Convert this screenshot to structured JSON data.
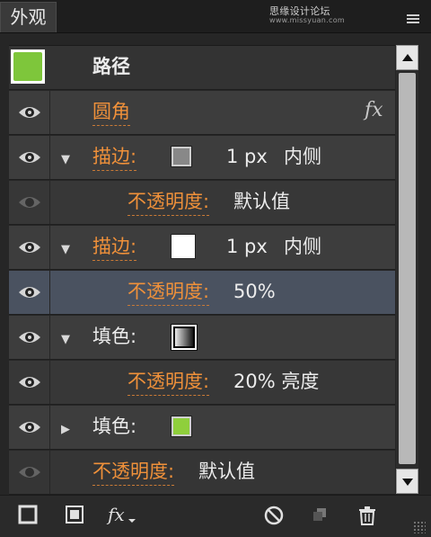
{
  "panel": {
    "tab_label": "外观"
  },
  "watermark": {
    "text": "思缘设计论坛",
    "sub": "www.missyuan.com"
  },
  "rows": {
    "header": {
      "label": "路径",
      "swatch_color": "#7ec63b"
    },
    "round": {
      "label": "圆角",
      "fx": "fx"
    },
    "stroke1": {
      "label": "描边:",
      "size": "1 px",
      "align": "内侧",
      "swatch_color": "#888888"
    },
    "stroke1_opacity": {
      "label": "不透明度:",
      "value": "默认值"
    },
    "stroke2": {
      "label": "描边:",
      "size": "1 px",
      "align": "内侧",
      "swatch_color": "#ffffff"
    },
    "stroke2_opacity": {
      "label": "不透明度:",
      "value": "50%"
    },
    "fill1": {
      "label": "填色:"
    },
    "fill1_opacity": {
      "label": "不透明度:",
      "value": "20% 亮度"
    },
    "fill2": {
      "label": "填色:",
      "swatch_color": "#8fcf3c"
    },
    "opacity": {
      "label": "不透明度:",
      "value": "默认值"
    }
  },
  "colors": {
    "accent": "#f0913a",
    "selected_row": "#4a5260"
  }
}
